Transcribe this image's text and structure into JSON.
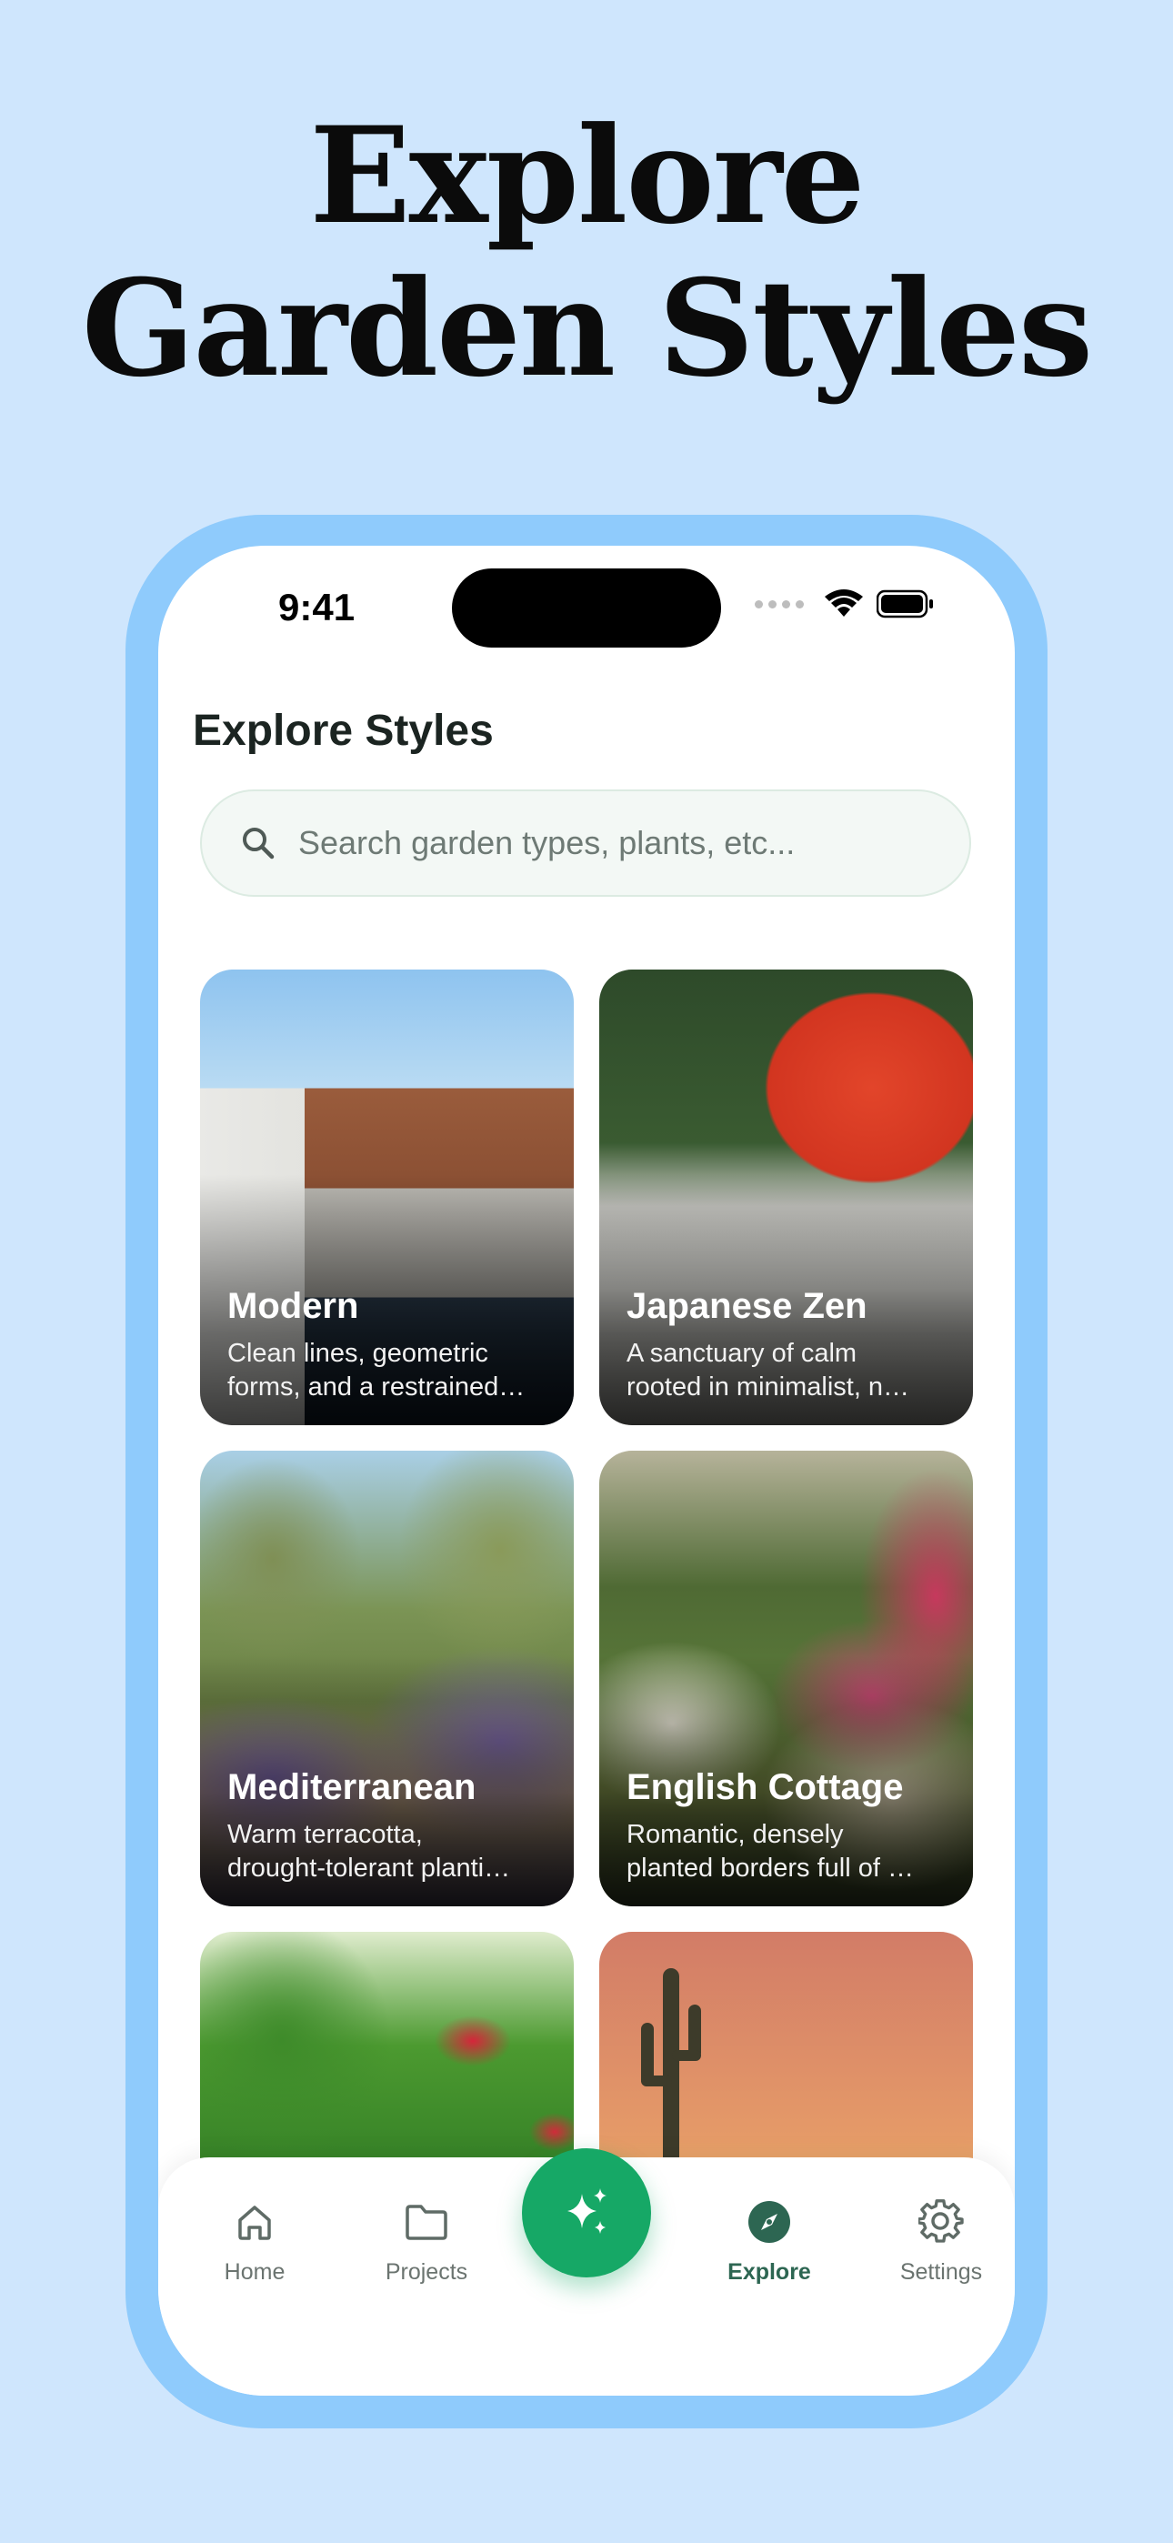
{
  "headline": {
    "line1": "Explore",
    "line2": "Garden Styles"
  },
  "status_bar": {
    "time": "9:41"
  },
  "page": {
    "title": "Explore Styles"
  },
  "search": {
    "placeholder": "Search garden types, plants, etc..."
  },
  "styles": [
    {
      "title": "Modern",
      "desc_line1": "Clean lines, geometric",
      "desc_line2": "forms, and a restrained…"
    },
    {
      "title": "Japanese Zen",
      "desc_line1": "A sanctuary of calm",
      "desc_line2": "rooted in minimalist, n…"
    },
    {
      "title": "Mediterranean",
      "desc_line1": "Warm terracotta,",
      "desc_line2": "drought-tolerant planti…"
    },
    {
      "title": "English Cottage",
      "desc_line1": "Romantic, densely",
      "desc_line2": "planted borders full of …"
    },
    {
      "title": "",
      "desc_line1": "",
      "desc_line2": ""
    },
    {
      "title": "",
      "desc_line1": "",
      "desc_line2": ""
    }
  ],
  "tab_bar": {
    "items": [
      {
        "label": "Home",
        "icon": "home-icon"
      },
      {
        "label": "Projects",
        "icon": "folder-icon"
      },
      {
        "label": "Explore",
        "icon": "compass-icon",
        "active": true
      },
      {
        "label": "Settings",
        "icon": "gear-icon"
      }
    ],
    "fab_icon": "sparkles-icon"
  },
  "colors": {
    "background": "#cfe6fd",
    "frame": "#8fcbfc",
    "accent_green": "#16a866",
    "active_tab": "#2d6652"
  }
}
